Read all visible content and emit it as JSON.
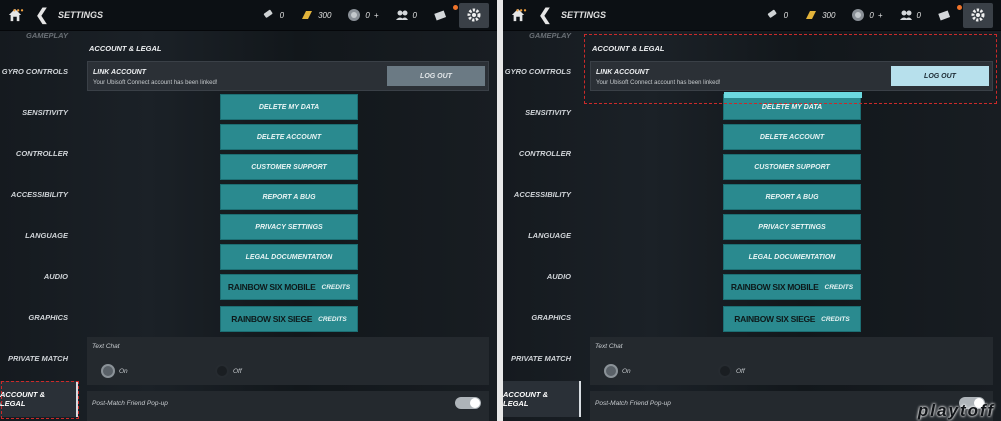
{
  "topbar": {
    "title": "SETTINGS",
    "dots": "•••",
    "currency": [
      {
        "icon": "renown-icon",
        "value": "0"
      },
      {
        "icon": "gold-bars-icon",
        "value": "300"
      },
      {
        "icon": "premium-coin-icon",
        "value": "0"
      },
      {
        "icon": "friends-icon",
        "value": "0"
      },
      {
        "icon": "mail-icon",
        "value": ""
      }
    ],
    "plus": "+"
  },
  "sidebar": {
    "cut_item": "GAMEPLAY",
    "items": [
      {
        "label": "GYRO CONTROLS"
      },
      {
        "label": "SENSITIVITY"
      },
      {
        "label": "CONTROLLER"
      },
      {
        "label": "ACCESSIBILITY"
      },
      {
        "label": "LANGUAGE"
      },
      {
        "label": "AUDIO"
      },
      {
        "label": "GRAPHICS"
      },
      {
        "label": "PRIVATE MATCH"
      },
      {
        "label": "ACCOUNT & LEGAL"
      }
    ]
  },
  "content": {
    "section_title": "ACCOUNT & LEGAL",
    "link_title": "LINK ACCOUNT",
    "link_desc": "Your Ubisoft Connect account has been linked!",
    "logout_label": "LOG OUT",
    "buttons": [
      {
        "label": "DELETE MY DATA"
      },
      {
        "label": "DELETE ACCOUNT"
      },
      {
        "label": "CUSTOMER SUPPORT"
      },
      {
        "label": "REPORT A BUG"
      },
      {
        "label": "PRIVACY SETTINGS"
      },
      {
        "label": "LEGAL DOCUMENTATION"
      }
    ],
    "credits": [
      {
        "logo": "RAINBOW SIX MOBILE",
        "label": "CREDITS"
      },
      {
        "logo": "RAINBOW SIX SIEGE",
        "label": "CREDITS"
      }
    ],
    "text_chat": {
      "label": "Text Chat",
      "on": "On",
      "off": "Off"
    },
    "post_match": {
      "label": "Post-Match Friend Pop-up"
    }
  },
  "watermark": "playtoff",
  "colors": {
    "teal_button": "#2a8a8f",
    "highlight_box": "#cc2a2a",
    "logout_active": "#b7e0ec",
    "logout_idle": "#6b7a84"
  }
}
